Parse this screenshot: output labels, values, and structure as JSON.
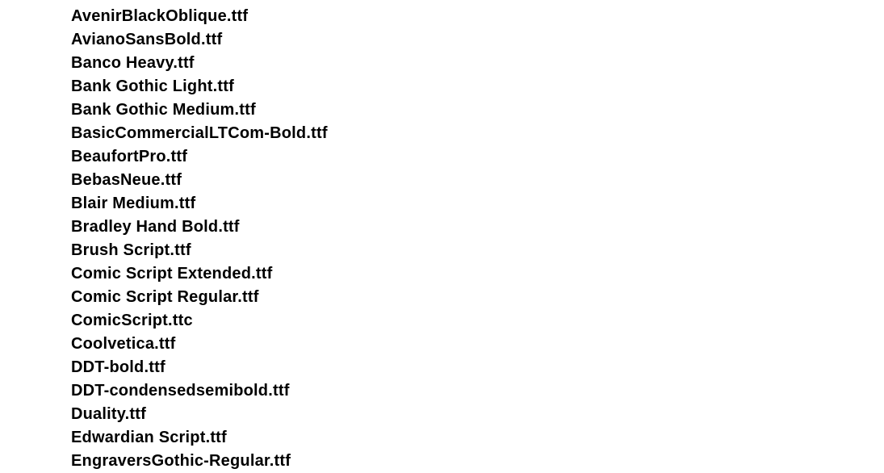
{
  "fonts": [
    "AvenirBlackOblique.ttf",
    "AvianoSansBold.ttf",
    "Banco Heavy.ttf",
    "Bank Gothic Light.ttf",
    "Bank Gothic Medium.ttf",
    "BasicCommercialLTCom-Bold.ttf",
    "BeaufortPro.ttf",
    "BebasNeue.ttf",
    "Blair Medium.ttf",
    "Bradley Hand Bold.ttf",
    "Brush Script.ttf",
    "Comic Script Extended.ttf",
    "Comic Script Regular.ttf",
    "ComicScript.ttc",
    "Coolvetica.ttf",
    "DDT-bold.ttf",
    "DDT-condensedsemibold.ttf",
    "Duality.ttf",
    "Edwardian Script.ttf",
    "EngraversGothic-Regular.ttf"
  ]
}
